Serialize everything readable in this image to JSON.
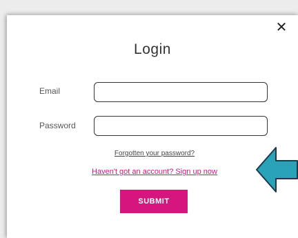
{
  "modal": {
    "title": "Login",
    "close_icon": "close-icon",
    "close_glyph": "✕"
  },
  "form": {
    "email_label": "Email",
    "email_value": "",
    "password_label": "Password",
    "password_value": "",
    "forgot_link": "Forgotten your password?",
    "signup_link": "Haven't got an account? Sign up now",
    "submit_label": "SUBMIT"
  },
  "annotation": {
    "arrow_icon": "left-arrow-icon",
    "arrow_color": "#2aa3b8"
  },
  "colors": {
    "accent": "#d6157f",
    "text": "#333333"
  }
}
